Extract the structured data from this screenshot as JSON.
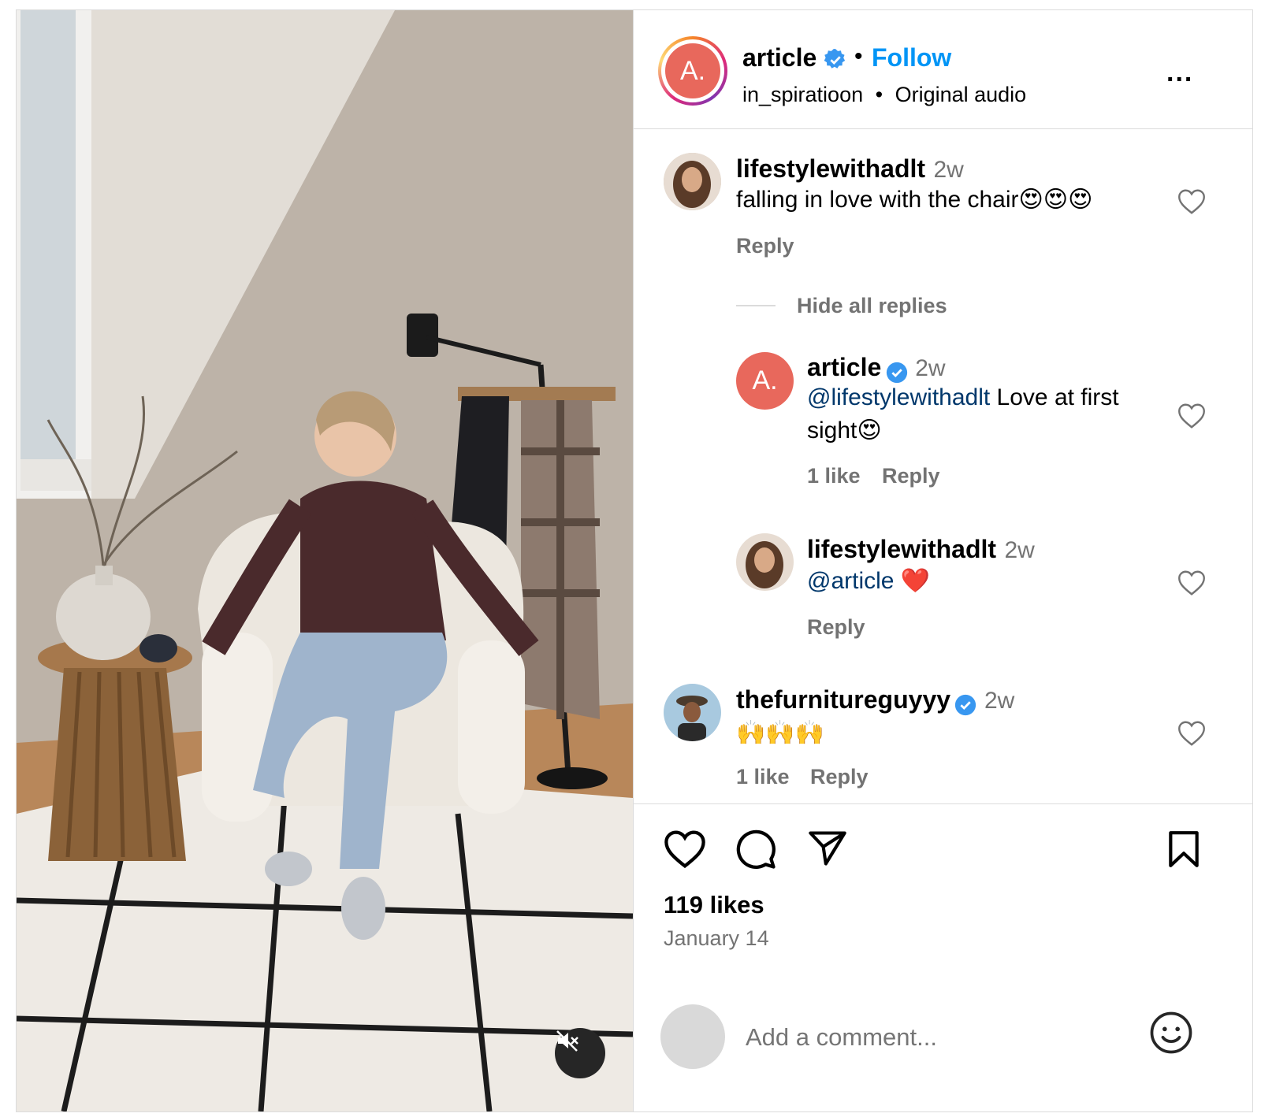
{
  "header": {
    "username": "article",
    "separator": "•",
    "follow_label": "Follow",
    "audio_user": "in_spiratioon",
    "audio_separator": "•",
    "audio_label": "Original audio",
    "avatar_letter": "A.",
    "more_label": "..."
  },
  "comments": [
    {
      "username": "lifestylewithadlt",
      "time": "2w",
      "text": "falling in love with the chair😍😍😍",
      "reply_label": "Reply"
    }
  ],
  "hide_replies_label": "Hide all replies",
  "replies": [
    {
      "username": "article",
      "time": "2w",
      "mention": "@lifestylewithadlt",
      "text_line1": " Love at first",
      "text_line2": "sight😍",
      "likes_label": "1 like",
      "reply_label": "Reply",
      "avatar_letter": "A."
    },
    {
      "username": "lifestylewithadlt",
      "time": "2w",
      "mention": "@article",
      "text": " ❤️",
      "reply_label": "Reply"
    }
  ],
  "comment3": {
    "username": "thefurnitureguyyy",
    "time": "2w",
    "text": "🙌🙌🙌",
    "likes_label": "1 like",
    "reply_label": "Reply"
  },
  "post": {
    "likes": "119 likes",
    "date": "January 14"
  },
  "add_comment": {
    "placeholder": "Add a comment..."
  },
  "icons": [
    "heart-icon",
    "comment-icon",
    "share-icon",
    "bookmark-icon",
    "emoji-icon",
    "mute-icon",
    "verified-icon",
    "more-icon"
  ],
  "colors": {
    "follow": "#0095f6",
    "verified": "#3897f0",
    "avatar_article": "#e8685c",
    "secondary_text": "#737373",
    "mention": "#00376b"
  }
}
